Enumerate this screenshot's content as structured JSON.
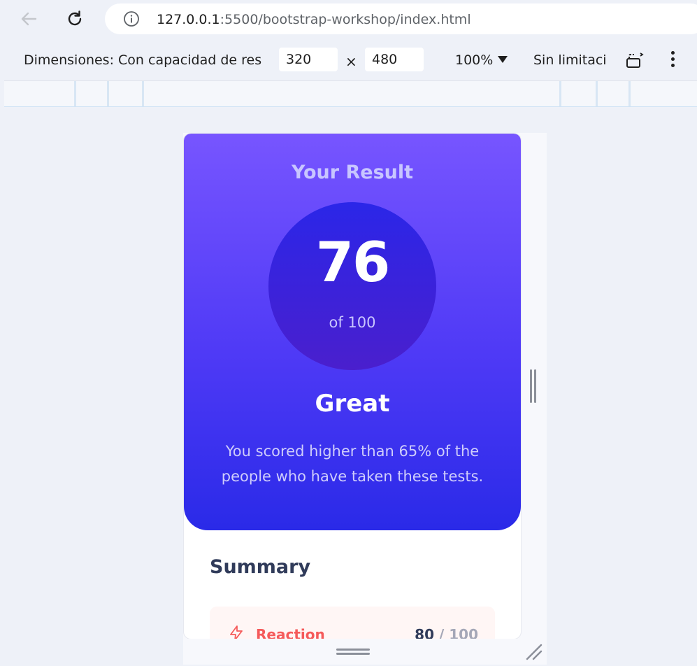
{
  "browser": {
    "url_host": "127.0.0.1",
    "url_rest": ":5500/bootstrap-workshop/index.html"
  },
  "device_toolbar": {
    "dimensions_label": "Dimensiones: Con capacidad de res",
    "width": "320",
    "separator": "×",
    "height": "480",
    "zoom": "100%",
    "throttle": "Sin limitaci"
  },
  "result": {
    "title": "Your Result",
    "score": "76",
    "score_total": "of 100",
    "rating": "Great",
    "description": "You scored higher than 65% of the people who have taken these tests."
  },
  "summary": {
    "title": "Summary",
    "items": [
      {
        "label": "Reaction",
        "score": "80",
        "total": "/ 100",
        "icon": "lightning-icon",
        "color": "#f55a5a"
      }
    ]
  },
  "colors": {
    "gradient_top": "#7755ff",
    "gradient_bottom": "#2a2ae8",
    "circle_top": "#2b26e8",
    "circle_bottom": "#4a1fcd"
  }
}
